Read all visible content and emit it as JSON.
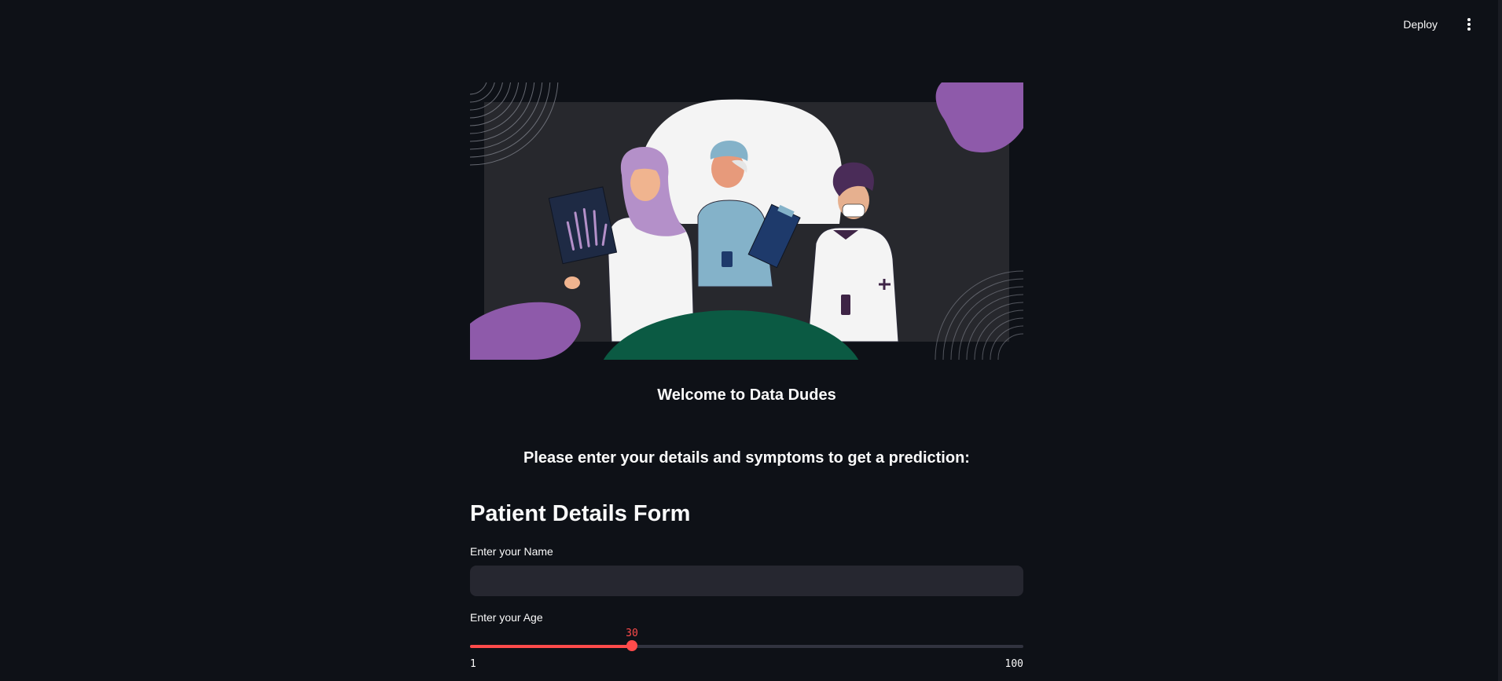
{
  "header": {
    "deploy_label": "Deploy",
    "menu_icon": "vertical-ellipsis-icon"
  },
  "hero": {
    "illustration": "doctors-illustration",
    "colors": {
      "panel": "#27282d",
      "blob_purple": "#8e5aaa",
      "hill_green": "#0b5a43"
    }
  },
  "welcome_text": "Welcome to Data Dudes",
  "subtitle_text": "Please enter your details and symptoms to get a prediction:",
  "form": {
    "title": "Patient Details Form",
    "name_label": "Enter your Name",
    "name_value": "",
    "age_label": "Enter your Age",
    "age": {
      "value": "30",
      "min": "1",
      "max": "100",
      "fraction": 0.293
    }
  },
  "colors": {
    "background": "#0e1117",
    "accent": "#ff4b4b",
    "input_bg": "#262730"
  }
}
